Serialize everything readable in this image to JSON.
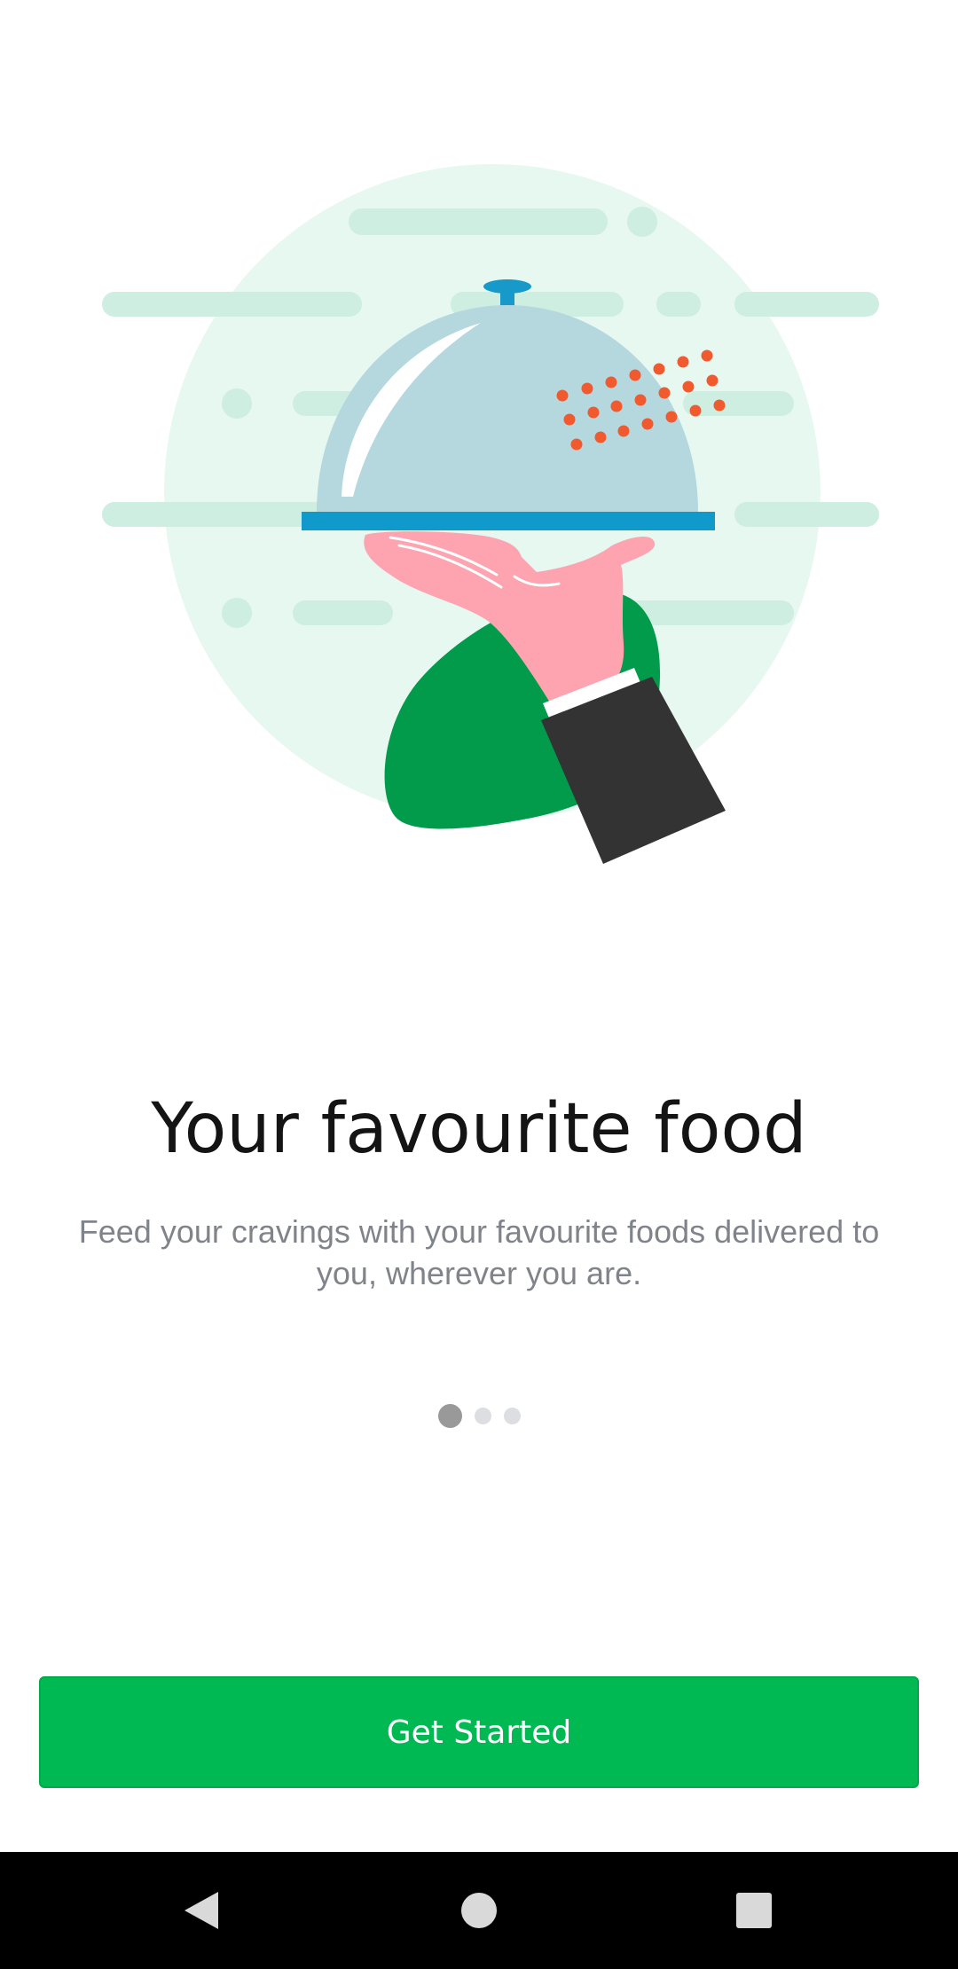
{
  "onboarding": {
    "title": "Your favourite food",
    "subtitle": "Feed your cravings with your favourite foods delivered to you, wherever you are.",
    "illustration_icon": "serving-cloche-illustration",
    "page_indicator": {
      "total": 3,
      "active_index": 0
    }
  },
  "actions": {
    "get_started_label": "Get Started"
  },
  "colors": {
    "accent": "#00b953",
    "title": "#141414",
    "subtitle": "#80848a",
    "indicator_active": "#999999",
    "indicator_inactive": "#dcdee2"
  },
  "system_nav": {
    "back_icon": "back-triangle-icon",
    "home_icon": "home-circle-icon",
    "recents_icon": "recents-square-icon"
  }
}
